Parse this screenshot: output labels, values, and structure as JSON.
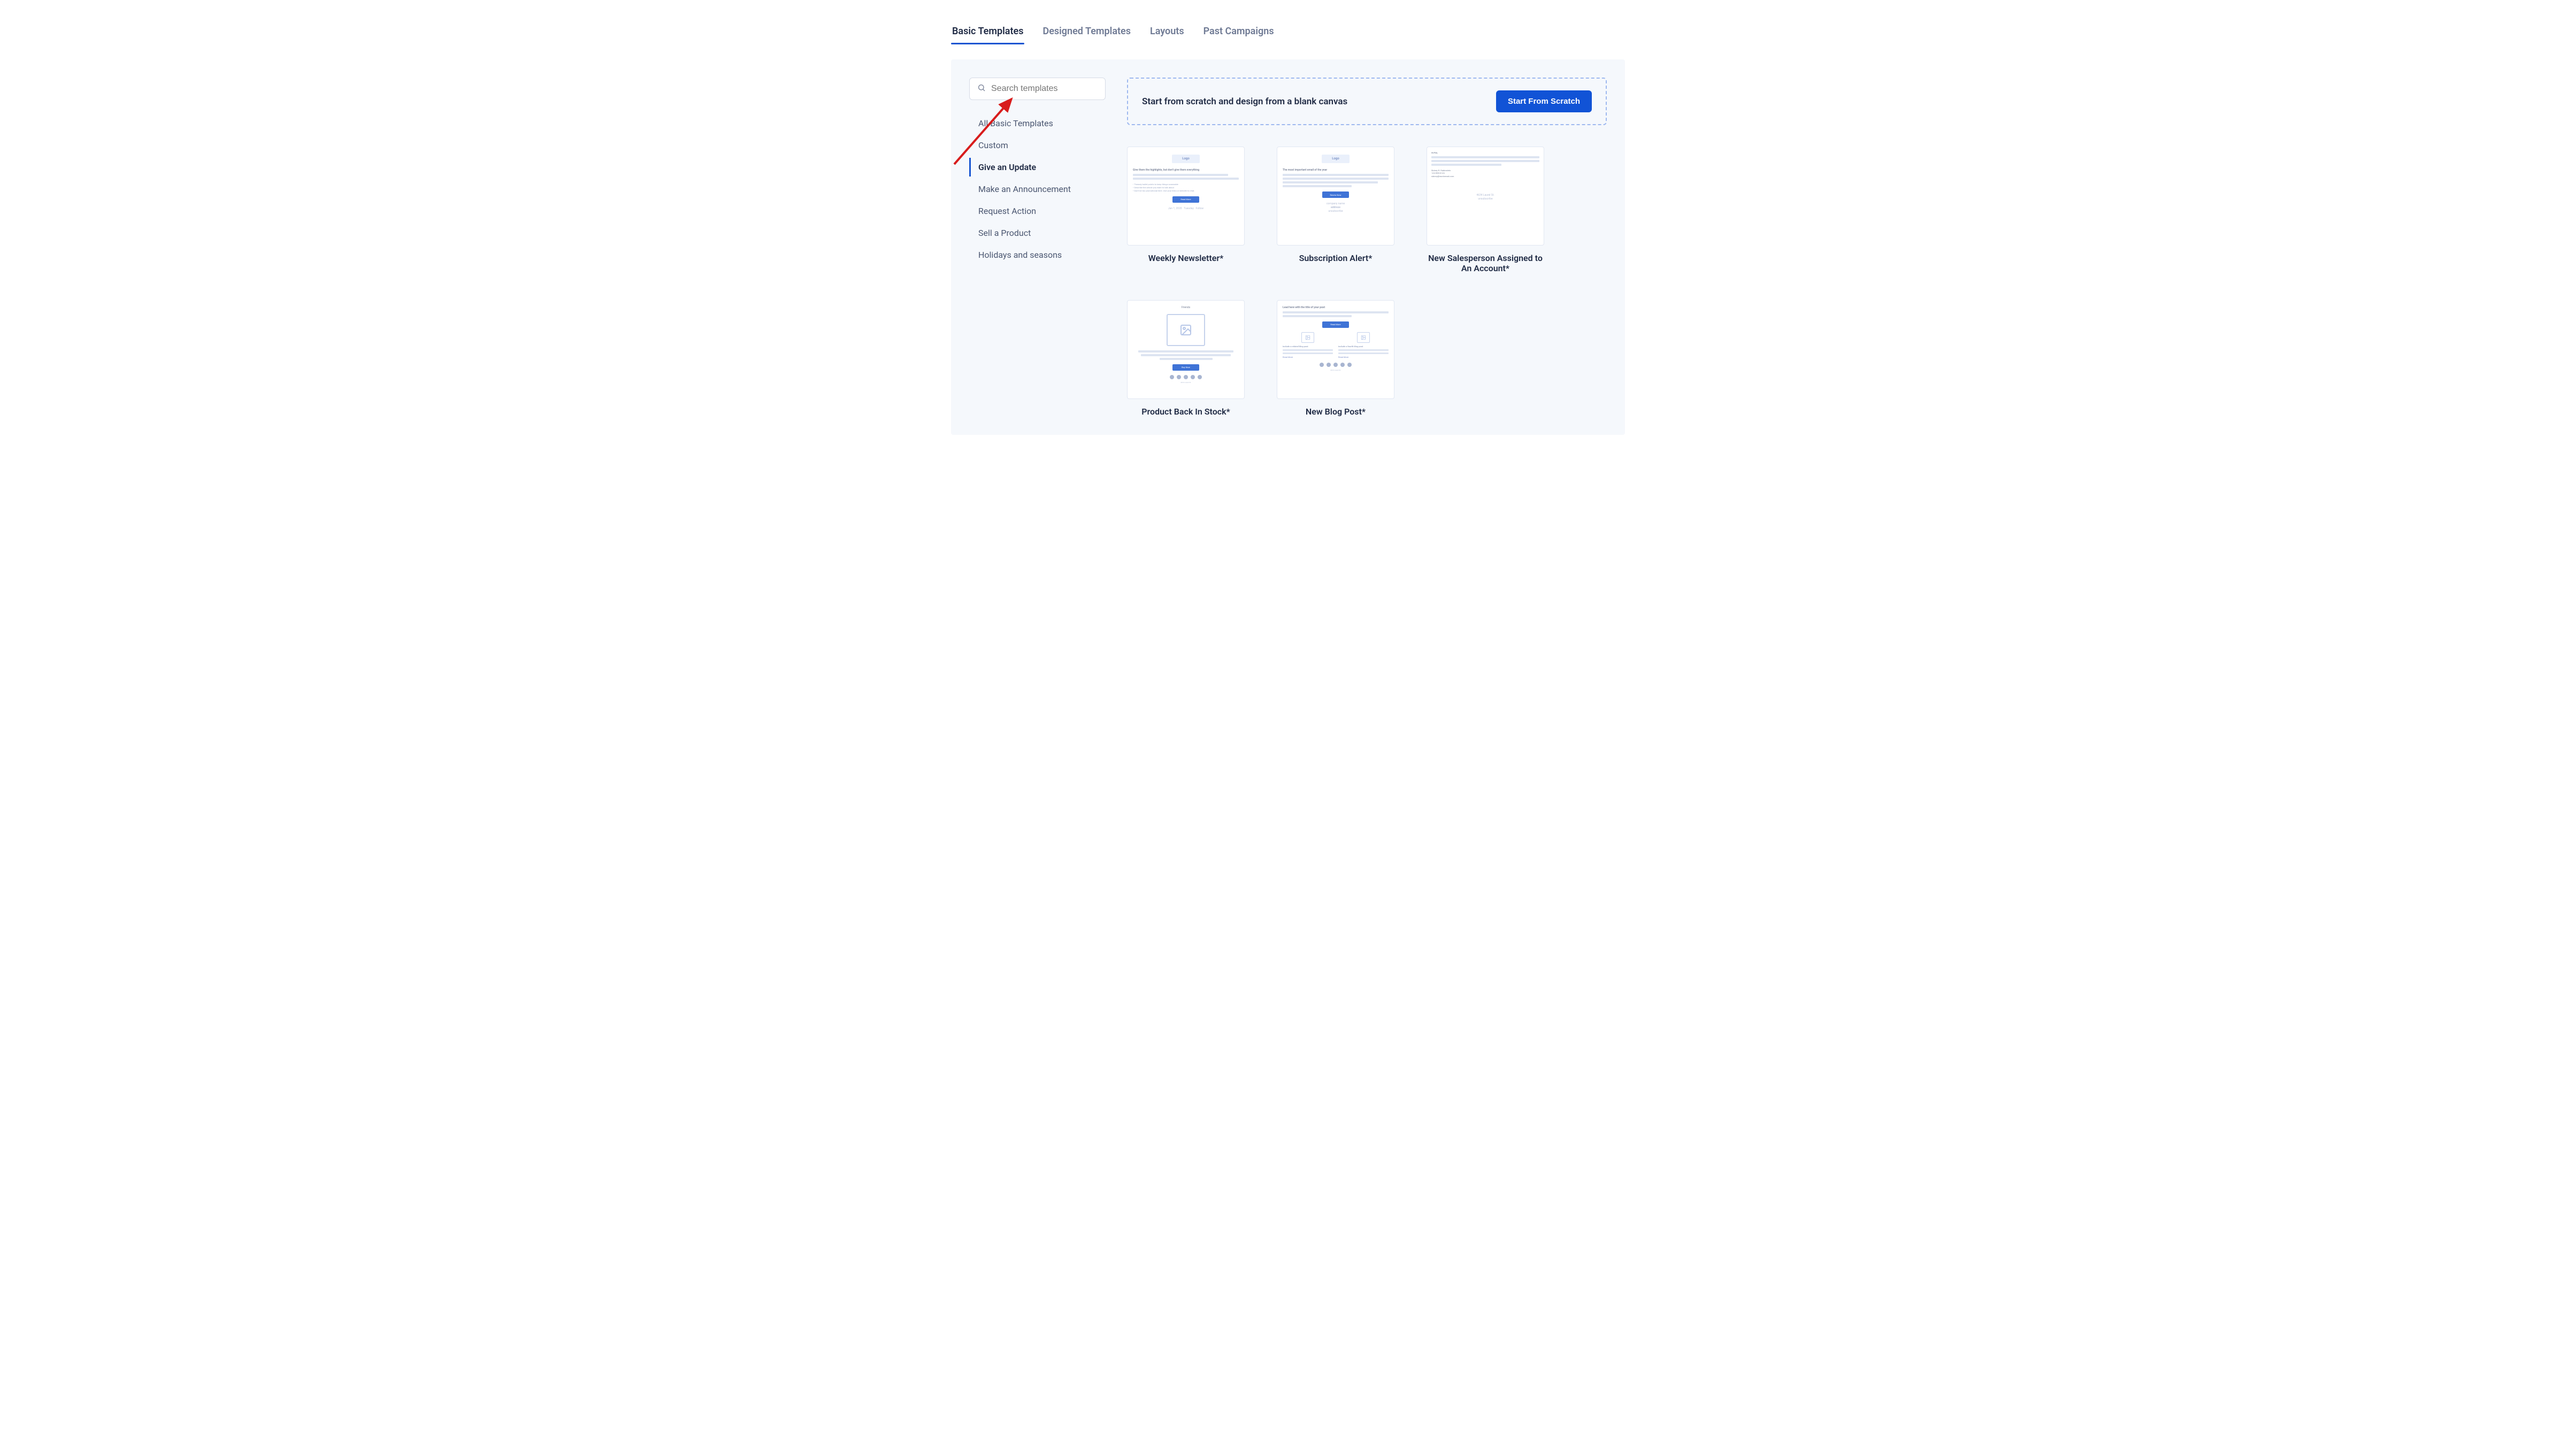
{
  "tabs": [
    {
      "label": "Basic Templates",
      "active": true
    },
    {
      "label": "Designed Templates",
      "active": false
    },
    {
      "label": "Layouts",
      "active": false
    },
    {
      "label": "Past Campaigns",
      "active": false
    }
  ],
  "search": {
    "placeholder": "Search templates"
  },
  "categories": [
    {
      "label": "All Basic Templates",
      "active": false
    },
    {
      "label": "Custom",
      "active": false
    },
    {
      "label": "Give an Update",
      "active": true
    },
    {
      "label": "Make an Announcement",
      "active": false
    },
    {
      "label": "Request Action",
      "active": false
    },
    {
      "label": "Sell a Product",
      "active": false
    },
    {
      "label": "Holidays and seasons",
      "active": false
    }
  ],
  "scratch": {
    "text": "Start from scratch and design from a blank canvas",
    "button": "Start From Scratch"
  },
  "templates": [
    {
      "label": "Weekly Newsletter*",
      "preview": "newsletter"
    },
    {
      "label": "Subscription Alert*",
      "preview": "subscription"
    },
    {
      "label": "New Salesperson Assigned to An Account*",
      "preview": "salesperson"
    },
    {
      "label": "Product Back In Stock*",
      "preview": "backinstock"
    },
    {
      "label": "New Blog Post*",
      "preview": "blogpost"
    }
  ],
  "preview_text": {
    "logo": "Logo",
    "friends": "Friends"
  }
}
